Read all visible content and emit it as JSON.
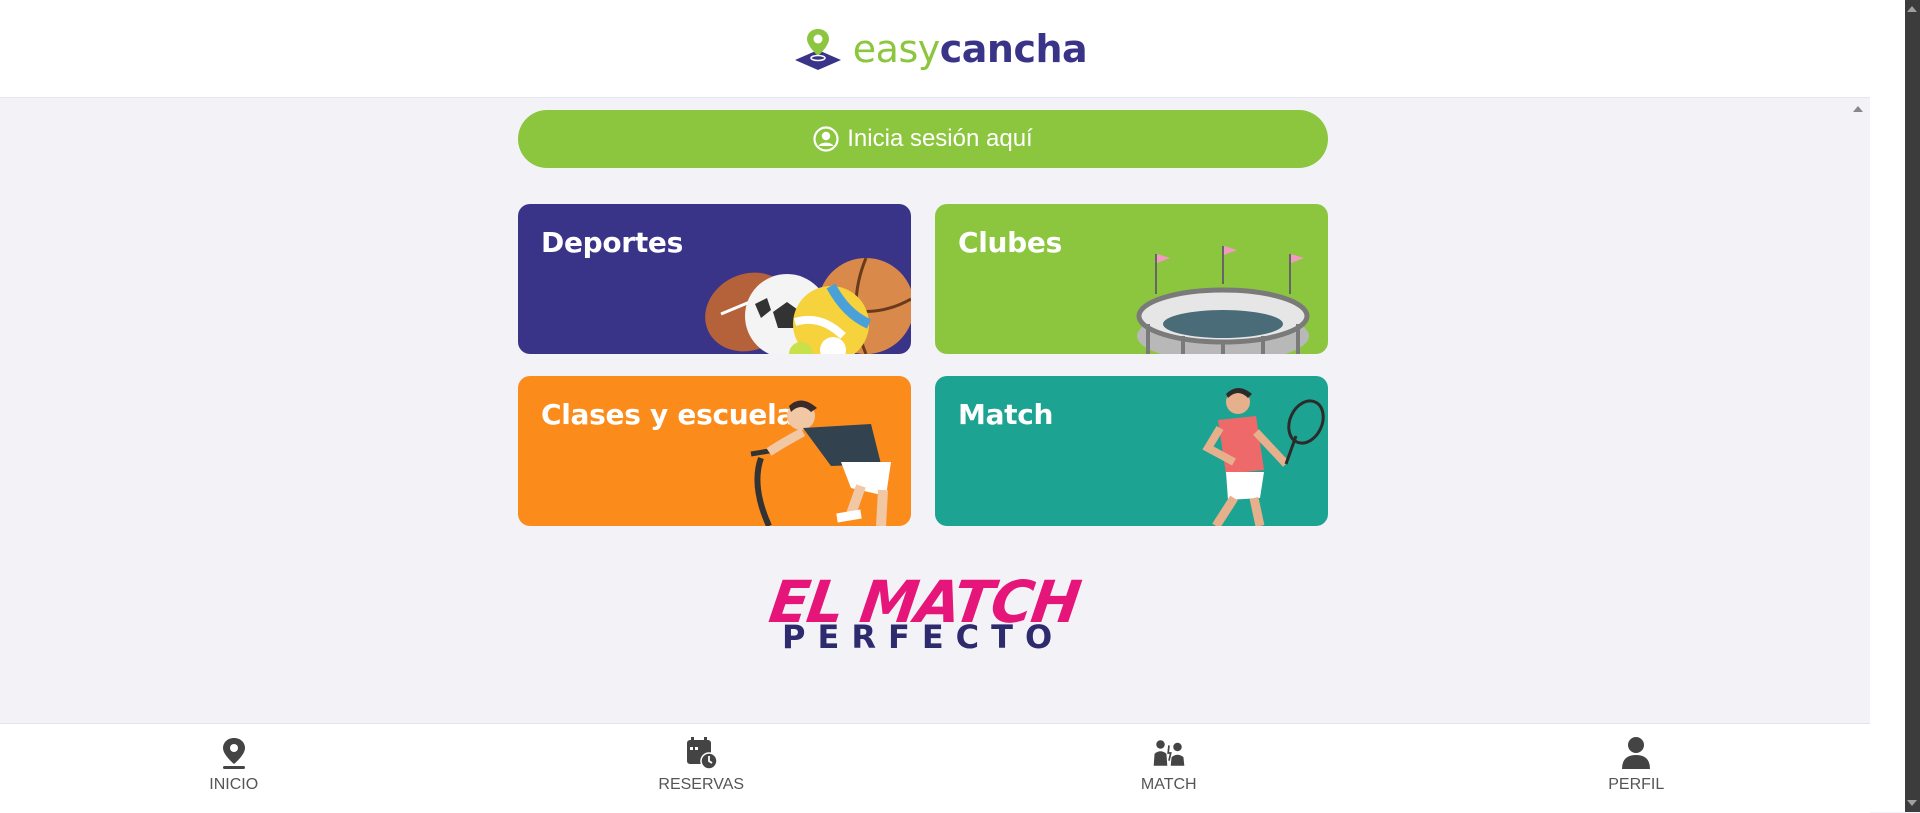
{
  "header": {
    "logo_easy": "easy",
    "logo_cancha": "cancha",
    "brand_colors": {
      "green": "#8cc63f",
      "navy": "#3a3489"
    }
  },
  "login": {
    "label": "Inicia sesión aquí",
    "icon": "user-circle-icon"
  },
  "cards": [
    {
      "title": "Deportes",
      "color": "#3a3489",
      "art": "sports-balls"
    },
    {
      "title": "Clubes",
      "color": "#8cc63f",
      "art": "stadium"
    },
    {
      "title": "Clases y escuelas",
      "color": "#fb8c1c",
      "art": "cyclist"
    },
    {
      "title": "Match",
      "color": "#1da392",
      "art": "tennis-player"
    }
  ],
  "promo": {
    "line1": "EL MATCH",
    "line2": "PERFECTO"
  },
  "bottom_nav": [
    {
      "label": "INICIO",
      "icon": "map-pin-icon"
    },
    {
      "label": "RESERVAS",
      "icon": "calendar-clock-icon"
    },
    {
      "label": "MATCH",
      "icon": "players-icon"
    },
    {
      "label": "PERFIL",
      "icon": "user-icon"
    }
  ]
}
